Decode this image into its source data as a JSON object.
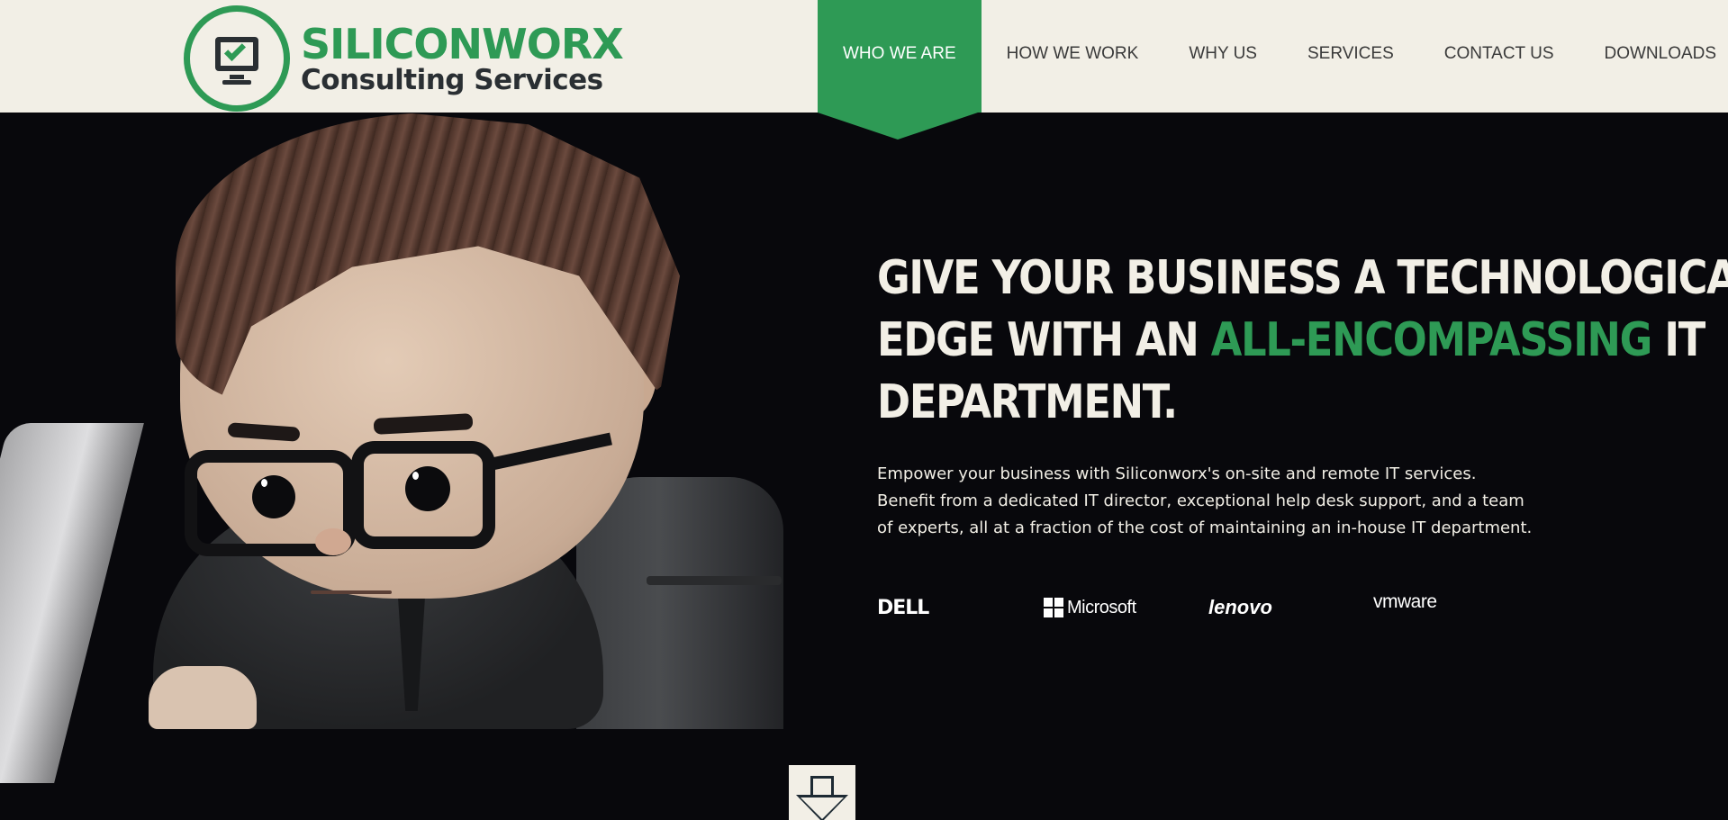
{
  "brand": {
    "name": "SILICONWORX",
    "subtitle": "Consulting Services",
    "logo_icon": "monitor-check-icon",
    "accent_color": "#2e9a55"
  },
  "nav": {
    "items": [
      {
        "label": "WHO WE ARE",
        "active": true
      },
      {
        "label": "HOW WE WORK",
        "active": false
      },
      {
        "label": "WHY US",
        "active": false
      },
      {
        "label": "SERVICES",
        "active": false
      },
      {
        "label": "CONTACT US",
        "active": false
      },
      {
        "label": "DOWNLOADS",
        "active": false
      }
    ]
  },
  "hero": {
    "headline_part1": "GIVE YOUR BUSINESS A TECHNOLOGICAL",
    "headline_part2": "EDGE WITH AN ",
    "headline_accent": "ALL-ENCOMPASSING",
    "headline_part3": " IT",
    "headline_part4": "DEPARTMENT.",
    "intro_line1": "Empower your business with Siliconworx's on-site and remote IT services.",
    "intro_line2": "Benefit from a dedicated IT director, exceptional help desk support, and a team",
    "intro_line3": "of experts, all at a fraction of the cost of maintaining an in-house IT department.",
    "illustration": "cartoon-it-professional-at-laptop"
  },
  "partners": {
    "dell": "DELL",
    "microsoft": "Microsoft",
    "lenovo": "lenovo",
    "vmware": "vmware"
  },
  "scroll": {
    "icon": "arrow-down-icon"
  },
  "colors": {
    "header_bg": "#f2efe6",
    "hero_bg": "#08080c",
    "text_light": "#f2efe6",
    "accent": "#2e9a55"
  }
}
